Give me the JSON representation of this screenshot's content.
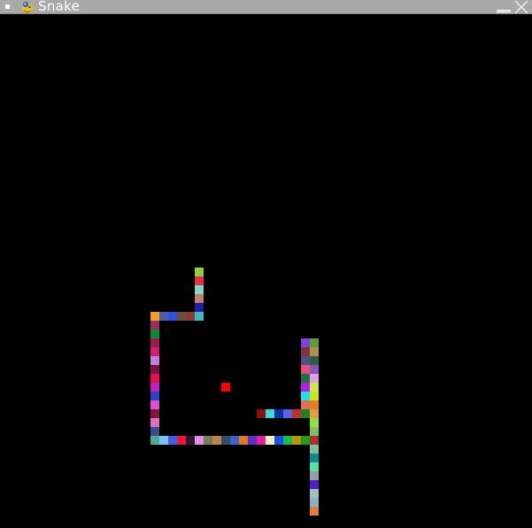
{
  "window": {
    "title": "Snake",
    "icons": {
      "menu": "window-menu-icon",
      "app": "snake-app-icon",
      "minimize": "minimize-icon",
      "close": "close-icon"
    }
  },
  "game": {
    "background": "#000000",
    "grid_unit": 10,
    "food": {
      "col": 25,
      "row": 43,
      "color": "#ff0000"
    },
    "snake": [
      {
        "col": 22,
        "row": 30,
        "color": "#8fd13a"
      },
      {
        "col": 22,
        "row": 31,
        "color": "#e8304a"
      },
      {
        "col": 22,
        "row": 32,
        "color": "#80d8c8"
      },
      {
        "col": 22,
        "row": 33,
        "color": "#c08070"
      },
      {
        "col": 22,
        "row": 34,
        "color": "#2020a0"
      },
      {
        "col": 22,
        "row": 35,
        "color": "#40b8c8"
      },
      {
        "col": 21,
        "row": 35,
        "color": "#8b3a3a"
      },
      {
        "col": 20,
        "row": 35,
        "color": "#6a5040"
      },
      {
        "col": 19,
        "row": 35,
        "color": "#3050e0"
      },
      {
        "col": 18,
        "row": 35,
        "color": "#5060a8"
      },
      {
        "col": 17,
        "row": 35,
        "color": "#f0a020"
      },
      {
        "col": 17,
        "row": 36,
        "color": "#9a3060"
      },
      {
        "col": 17,
        "row": 37,
        "color": "#108838"
      },
      {
        "col": 17,
        "row": 38,
        "color": "#a01850"
      },
      {
        "col": 17,
        "row": 39,
        "color": "#d02070"
      },
      {
        "col": 17,
        "row": 40,
        "color": "#c080e0"
      },
      {
        "col": 17,
        "row": 41,
        "color": "#801040"
      },
      {
        "col": 17,
        "row": 42,
        "color": "#e0104a"
      },
      {
        "col": 17,
        "row": 43,
        "color": "#c020c0"
      },
      {
        "col": 17,
        "row": 44,
        "color": "#3040c0"
      },
      {
        "col": 17,
        "row": 45,
        "color": "#e050d0"
      },
      {
        "col": 17,
        "row": 46,
        "color": "#801838"
      },
      {
        "col": 17,
        "row": 47,
        "color": "#e070c0"
      },
      {
        "col": 17,
        "row": 48,
        "color": "#404888"
      },
      {
        "col": 17,
        "row": 49,
        "color": "#50a890"
      },
      {
        "col": 18,
        "row": 49,
        "color": "#80c0f0"
      },
      {
        "col": 19,
        "row": 49,
        "color": "#4060e0"
      },
      {
        "col": 20,
        "row": 49,
        "color": "#e81838"
      },
      {
        "col": 21,
        "row": 49,
        "color": "#301828"
      },
      {
        "col": 22,
        "row": 49,
        "color": "#e090e0"
      },
      {
        "col": 23,
        "row": 49,
        "color": "#708050"
      },
      {
        "col": 24,
        "row": 49,
        "color": "#c08050"
      },
      {
        "col": 25,
        "row": 49,
        "color": "#305060"
      },
      {
        "col": 26,
        "row": 49,
        "color": "#4060d0"
      },
      {
        "col": 27,
        "row": 49,
        "color": "#e07820"
      },
      {
        "col": 28,
        "row": 49,
        "color": "#6030c0"
      },
      {
        "col": 29,
        "row": 49,
        "color": "#e020a0"
      },
      {
        "col": 30,
        "row": 49,
        "color": "#f0f0c0"
      },
      {
        "col": 31,
        "row": 49,
        "color": "#2050e0"
      },
      {
        "col": 32,
        "row": 49,
        "color": "#10c050"
      },
      {
        "col": 33,
        "row": 49,
        "color": "#c09010"
      },
      {
        "col": 34,
        "row": 49,
        "color": "#20a020"
      },
      {
        "col": 35,
        "row": 49,
        "color": "#b03030"
      },
      {
        "col": 35,
        "row": 48,
        "color": "#80c060"
      },
      {
        "col": 35,
        "row": 47,
        "color": "#90e040"
      },
      {
        "col": 35,
        "row": 46,
        "color": "#e0a040"
      },
      {
        "col": 35,
        "row": 45,
        "color": "#e08020"
      },
      {
        "col": 35,
        "row": 44,
        "color": "#d0e020"
      },
      {
        "col": 35,
        "row": 43,
        "color": "#d0e050"
      },
      {
        "col": 35,
        "row": 42,
        "color": "#e0a0e0"
      },
      {
        "col": 35,
        "row": 41,
        "color": "#9050c0"
      },
      {
        "col": 35,
        "row": 40,
        "color": "#306040"
      },
      {
        "col": 35,
        "row": 39,
        "color": "#b09050"
      },
      {
        "col": 35,
        "row": 38,
        "color": "#60a030"
      },
      {
        "col": 34,
        "row": 38,
        "color": "#8040e0"
      },
      {
        "col": 34,
        "row": 39,
        "color": "#803040"
      },
      {
        "col": 34,
        "row": 40,
        "color": "#505080"
      },
      {
        "col": 34,
        "row": 41,
        "color": "#e05080"
      },
      {
        "col": 34,
        "row": 42,
        "color": "#207040"
      },
      {
        "col": 34,
        "row": 43,
        "color": "#b020e0"
      },
      {
        "col": 34,
        "row": 44,
        "color": "#20e0f0"
      },
      {
        "col": 34,
        "row": 45,
        "color": "#e07050"
      },
      {
        "col": 34,
        "row": 46,
        "color": "#208020"
      },
      {
        "col": 33,
        "row": 46,
        "color": "#c03030"
      },
      {
        "col": 32,
        "row": 46,
        "color": "#6060e0"
      },
      {
        "col": 31,
        "row": 46,
        "color": "#1030a0"
      },
      {
        "col": 30,
        "row": 46,
        "color": "#40d8e0"
      },
      {
        "col": 29,
        "row": 46,
        "color": "#901010"
      },
      {
        "col": 35,
        "row": 50,
        "color": "#80c0a0"
      },
      {
        "col": 35,
        "row": 51,
        "color": "#108890"
      },
      {
        "col": 35,
        "row": 52,
        "color": "#60e0a0"
      },
      {
        "col": 35,
        "row": 53,
        "color": "#90a0a0"
      },
      {
        "col": 35,
        "row": 54,
        "color": "#5020c0"
      },
      {
        "col": 35,
        "row": 55,
        "color": "#a0c0c0"
      },
      {
        "col": 35,
        "row": 56,
        "color": "#90b0c0"
      },
      {
        "col": 35,
        "row": 57,
        "color": "#e08040"
      }
    ]
  }
}
